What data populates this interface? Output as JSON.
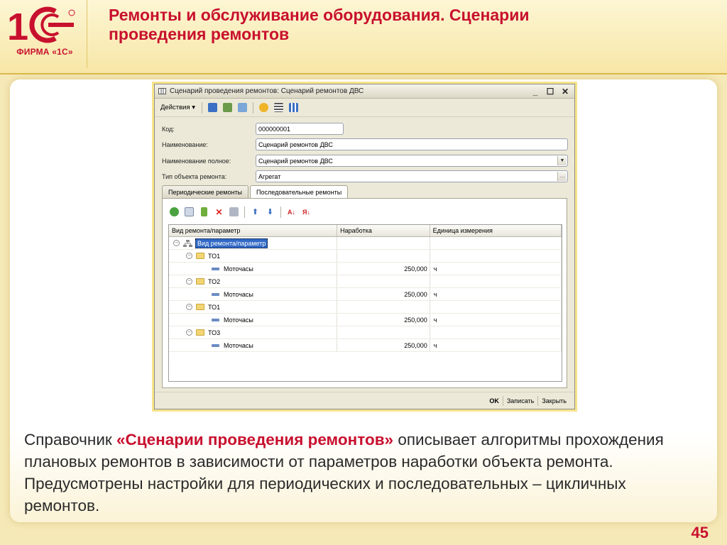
{
  "slide": {
    "title": "Ремонты и обслуживание оборудования. Сценарии проведения ремонтов",
    "logo_caption": "ФИРМА «1С»",
    "page_number": "45",
    "colors": {
      "brand": "#c8102e",
      "background": "#f6e9b8",
      "highlight_frame": "#f7e48a"
    }
  },
  "window": {
    "title": "Сценарий проведения ремонтов: Сценарий ремонтов ДВС",
    "toolbar": {
      "actions_label": "Действия ▾"
    },
    "form": {
      "code_label": "Код:",
      "code_value": "000000001",
      "name_label": "Наименование:",
      "name_value": "Сценарий ремонтов ДВС",
      "full_name_label": "Наименование полное:",
      "full_name_value": "Сценарий ремонтов ДВС",
      "object_type_label": "Тип объекта ремонта:",
      "object_type_value": "Агрегат"
    },
    "tabs": [
      {
        "label": "Периодические ремонты"
      },
      {
        "label": "Последовательные ремонты"
      }
    ],
    "grid": {
      "columns": [
        "Вид ремонта/параметр",
        "Наработка",
        "Единица измерения"
      ],
      "root_label": "Вид ремонта/параметр",
      "rows": [
        {
          "name": "ТО1",
          "param": "Моточасы",
          "value": "250,000",
          "unit": "ч"
        },
        {
          "name": "ТО2",
          "param": "Моточасы",
          "value": "250,000",
          "unit": "ч"
        },
        {
          "name": "ТО1",
          "param": "Моточасы",
          "value": "250,000",
          "unit": "ч"
        },
        {
          "name": "ТО3",
          "param": "Моточасы",
          "value": "250,000",
          "unit": "ч"
        }
      ]
    },
    "footer": {
      "ok": "OK",
      "save": "Записать",
      "close": "Закрыть"
    }
  },
  "description": {
    "prefix": "Справочник ",
    "highlight": "«Сценарии проведения ремонтов»",
    "suffix": " описывает алгоритмы прохождения плановых ремонтов в зависимости от параметров наработки объекта ремонта. Предусмотрены настройки для периодических и последовательных – цикличных ремонтов."
  }
}
